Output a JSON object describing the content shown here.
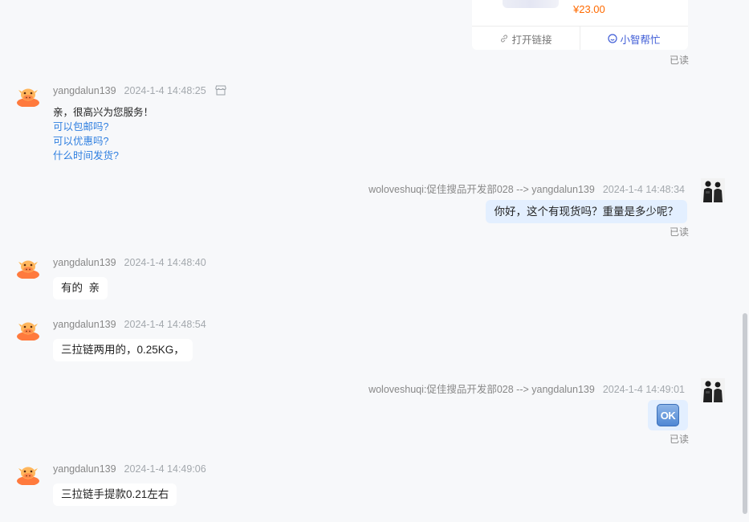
{
  "product_card": {
    "price": "¥23.00",
    "open_link_label": "打开链接",
    "helper_label": "小智帮忙"
  },
  "read_label": "已读",
  "messages": [
    {
      "sender": "yangdalun139",
      "time": "2024-1-4 14:48:25",
      "text": "亲，很高兴为您服务！",
      "quick_replies": [
        "可以包邮吗?",
        "可以优惠吗?",
        "什么时间发货?"
      ]
    },
    {
      "sender": "woloveshuqi:促佳搜品开发部028 --> yangdalun139",
      "time": "2024-1-4 14:48:34",
      "text": "你好，这个有现货吗？重量是多少呢？"
    },
    {
      "sender": "yangdalun139",
      "time": "2024-1-4 14:48:40",
      "text": "有的  亲"
    },
    {
      "sender": "yangdalun139",
      "time": "2024-1-4 14:48:54",
      "text": "三拉链两用的，0.25KG，"
    },
    {
      "sender": "woloveshuqi:促佳搜品开发部028 --> yangdalun139",
      "time": "2024-1-4 14:49:01",
      "emoji_text": "OK"
    },
    {
      "sender": "yangdalun139",
      "time": "2024-1-4 14:49:06",
      "text": "三拉链手提款0.21左右"
    }
  ],
  "icons": {
    "shop": "store-icon",
    "link": "link-icon",
    "helper": "smile-icon",
    "bot_avatar": "cow-avatar-icon",
    "user_avatar": "user-photo-avatar"
  },
  "colors": {
    "background": "#f7f8fa",
    "my_bubble": "#e3efff",
    "link": "#2f7fe0",
    "price": "#ff6a00",
    "helper": "#3d5bd6"
  }
}
